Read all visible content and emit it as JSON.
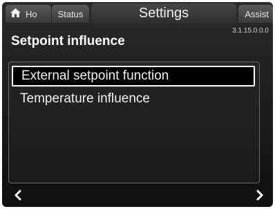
{
  "tabs": {
    "home": {
      "label": "Ho",
      "icon": "home-icon"
    },
    "status": {
      "label": "Status"
    },
    "settings": {
      "label": "Settings"
    },
    "assist": {
      "label": "Assist"
    }
  },
  "version": "3.1.15.0.0.0",
  "page_title": "Setpoint influence",
  "list": {
    "items": [
      {
        "label": "External setpoint function",
        "selected": true
      },
      {
        "label": "Temperature influence",
        "selected": false
      }
    ]
  },
  "nav": {
    "prev_icon": "chevron-left-icon",
    "next_icon": "chevron-right-icon"
  },
  "colors": {
    "background": "#1b1b1b",
    "text": "#ffffff",
    "selection_border": "#ffffff"
  }
}
